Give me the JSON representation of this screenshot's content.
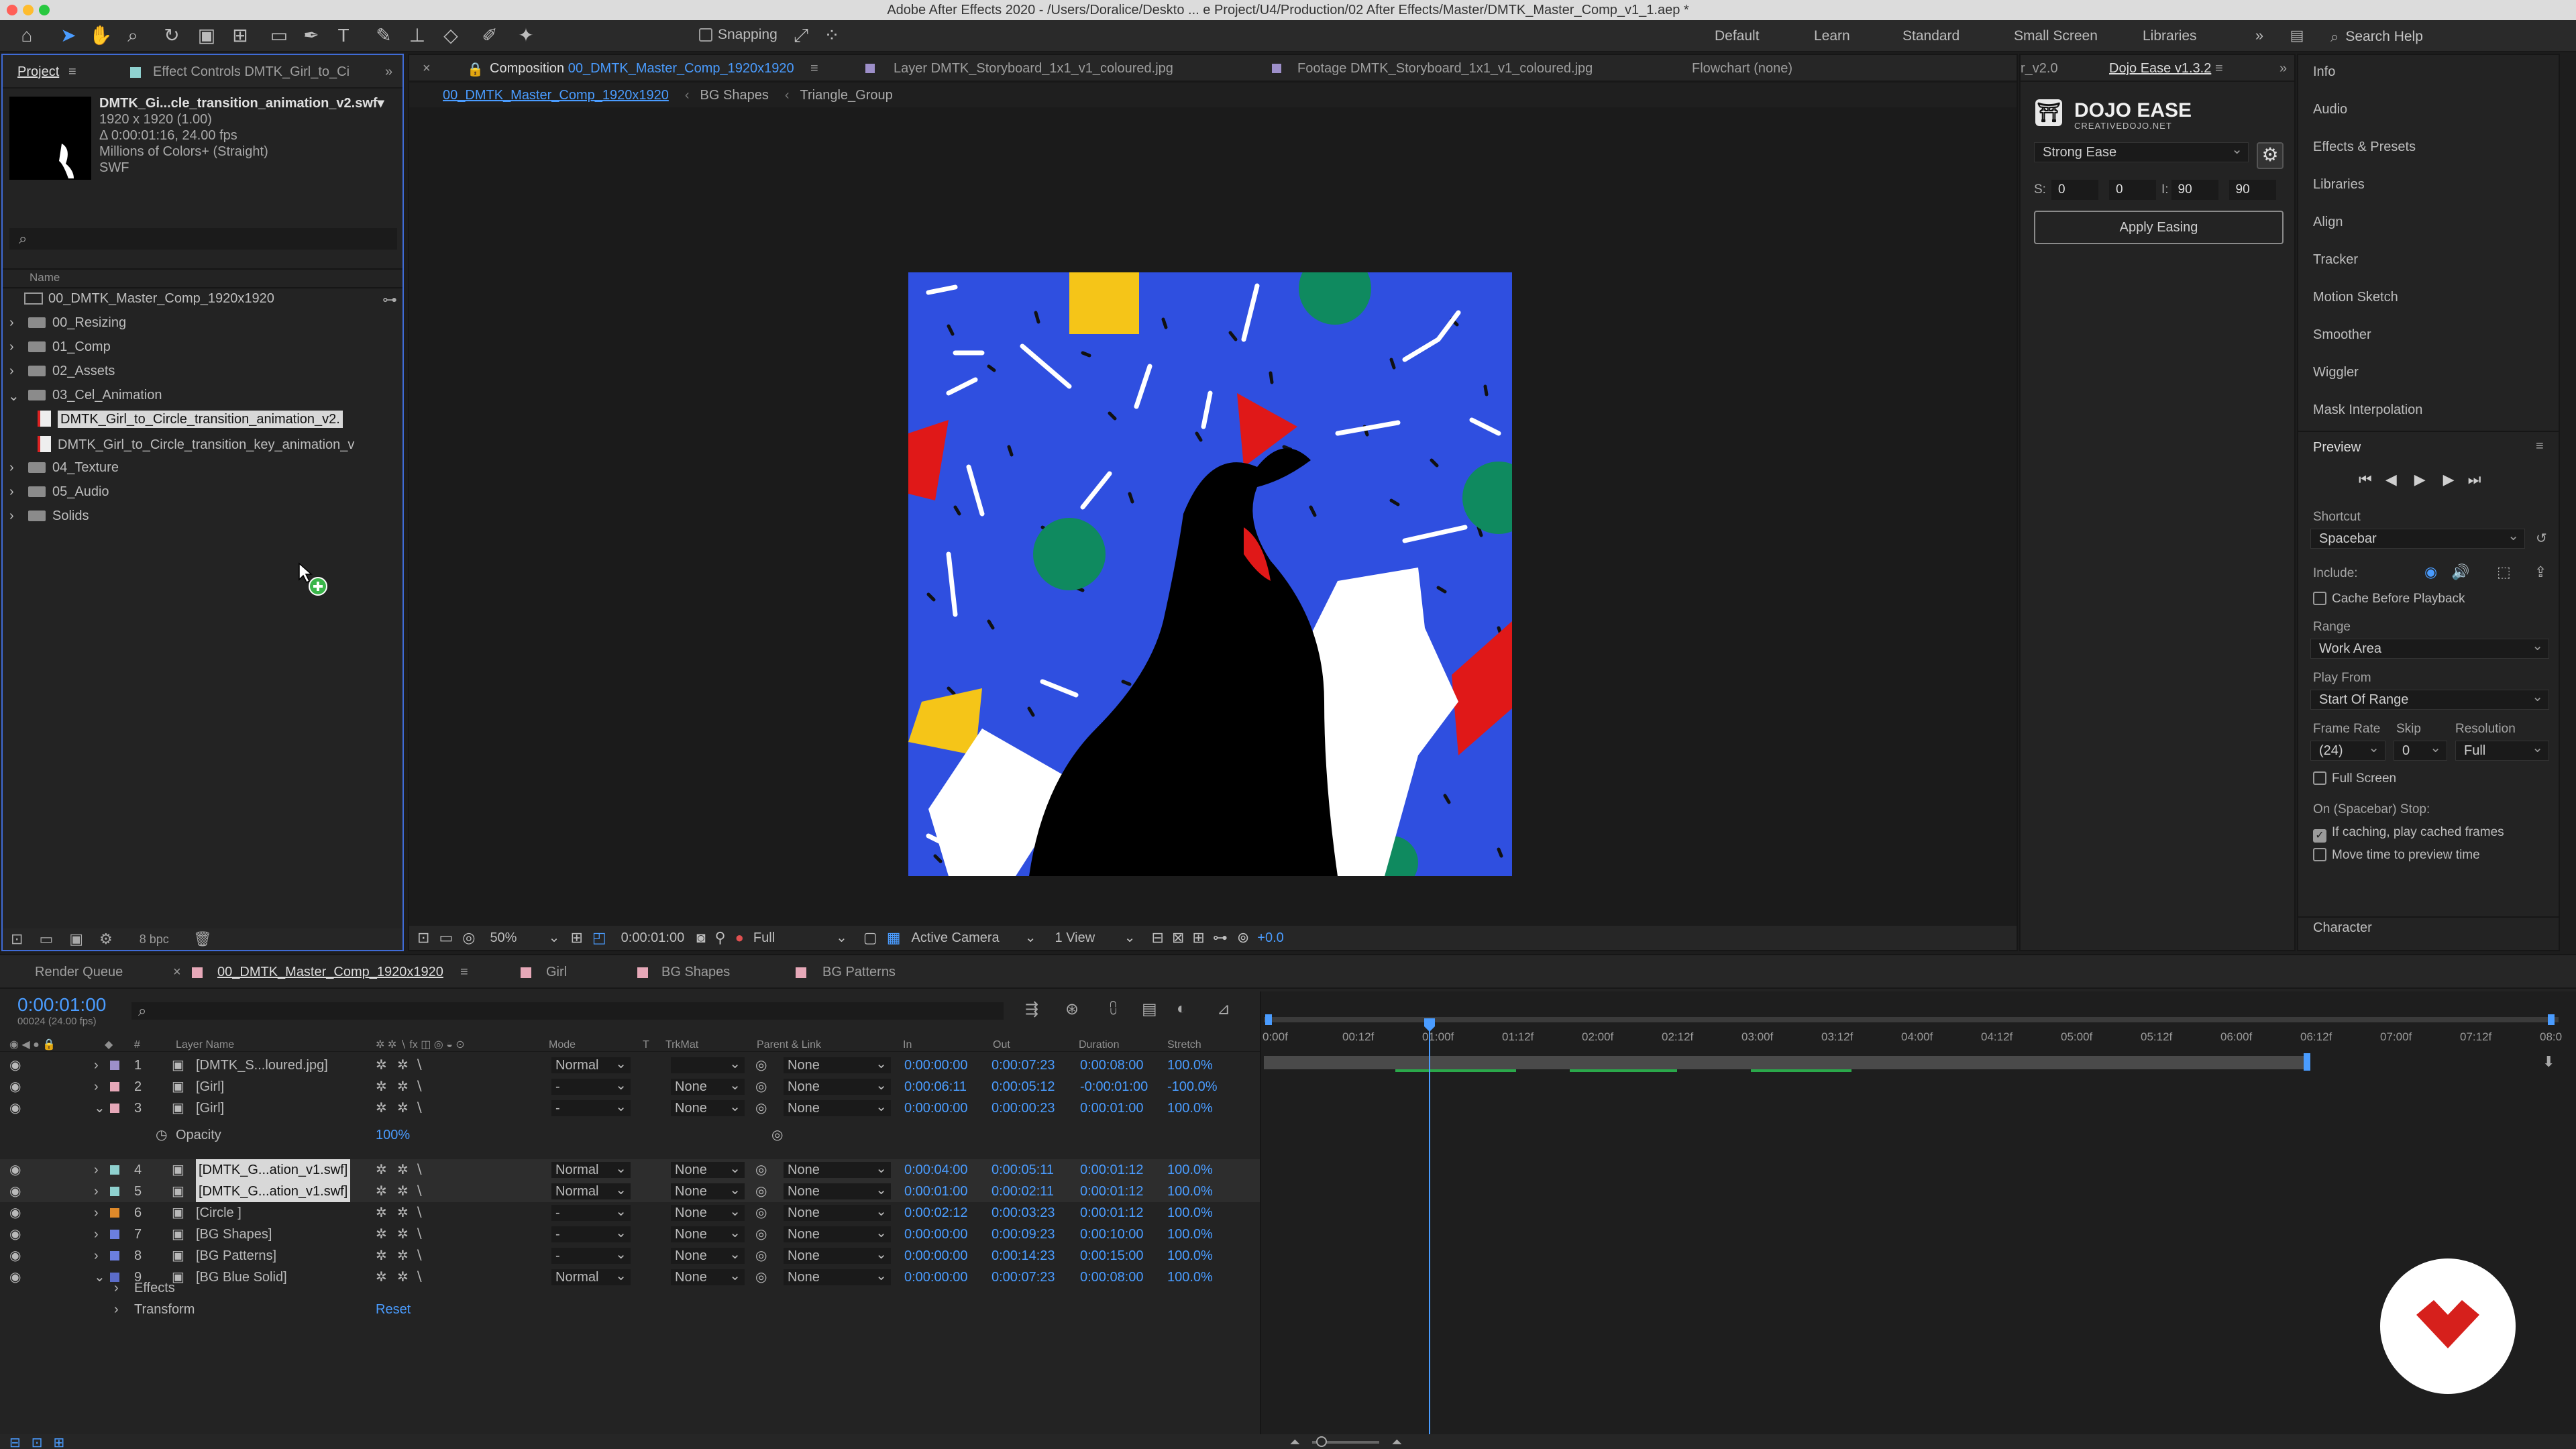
{
  "app": {
    "title": "Adobe After Effects 2020 - /Users/Doralice/Deskto ... e Project/U4/Production/02 After Effects/Master/DMTK_Master_Comp_v1_1.aep *"
  },
  "toolbar": {
    "snapping_label": "Snapping",
    "workspaces": [
      "Default",
      "Learn",
      "Standard",
      "Small Screen",
      "Libraries"
    ],
    "search_placeholder": "Search Help"
  },
  "project_panel": {
    "tab_project": "Project",
    "tab_effect_controls": "Effect Controls DMTK_Girl_to_Ci",
    "preview": {
      "name": "DMTK_Gi...cle_transition_animation_v2.swf▾",
      "line1": "1920 x 1920 (1.00)",
      "line2": "Δ 0:00:01:16, 24.00 fps",
      "line3": "Millions of Colors+ (Straight)",
      "line4": "SWF"
    },
    "column_name": "Name",
    "items": [
      {
        "label": "00_DMTK_Master_Comp_1920x1920",
        "type": "comp"
      },
      {
        "label": "00_Resizing",
        "type": "folder"
      },
      {
        "label": "01_Comp",
        "type": "folder"
      },
      {
        "label": "02_Assets",
        "type": "folder"
      },
      {
        "label": "03_Cel_Animation",
        "type": "folder-open"
      },
      {
        "label": "DMTK_Girl_to_Circle_transition_animation_v2.",
        "type": "swf"
      },
      {
        "label": "DMTK_Girl_to_Circle_transition_key_animation_v",
        "type": "swf"
      },
      {
        "label": "04_Texture",
        "type": "folder"
      },
      {
        "label": "05_Audio",
        "type": "folder"
      },
      {
        "label": "Solids",
        "type": "folder"
      }
    ],
    "bpc": "8 bpc"
  },
  "comp_panel": {
    "tab_composition_prefix": "Composition",
    "tab_composition_name": "00_DMTK_Master_Comp_1920x1920",
    "tab_layer": "Layer DMTK_Storyboard_1x1_v1_coloured.jpg",
    "tab_footage": "Footage DMTK_Storyboard_1x1_v1_coloured.jpg",
    "tab_flowchart": "Flowchart (none)",
    "breadcrumbs": [
      "00_DMTK_Master_Comp_1920x1920",
      "BG Shapes",
      "Triangle_Group"
    ],
    "footer": {
      "zoom": "50%",
      "time": "0:00:01:00",
      "resolution": "Full",
      "camera": "Active Camera",
      "views": "1 View",
      "exposure": "+0.0"
    }
  },
  "dojo_panel": {
    "tab_version_short": "r_v2.0",
    "tab_label": "Dojo Ease v1.3.2",
    "brand": "DOJO EASE",
    "brand_sub": "CREATIVEDOJO.NET",
    "preset": "Strong Ease",
    "s_label": "S:",
    "s_values": [
      "0",
      "0"
    ],
    "i_label": "I:",
    "i_values": [
      "90",
      "90"
    ],
    "apply_label": "Apply Easing"
  },
  "right_panel": {
    "items": [
      "Info",
      "Audio",
      "Effects & Presets",
      "Libraries",
      "Align",
      "Tracker",
      "Motion Sketch",
      "Smoother",
      "Wiggler",
      "Mask Interpolation"
    ],
    "preview": {
      "title": "Preview",
      "shortcut_label": "Shortcut",
      "shortcut_value": "Spacebar",
      "include_label": "Include:",
      "cache_label": "Cache Before Playback",
      "range_label": "Range",
      "range_value": "Work Area",
      "play_from_label": "Play From",
      "play_from_value": "Start Of Range",
      "frame_rate_label": "Frame Rate",
      "skip_label": "Skip",
      "resolution_label": "Resolution",
      "frame_rate_value": "(24)",
      "skip_value": "0",
      "resolution_value": "Full",
      "full_screen_label": "Full Screen",
      "stop_label": "On (Spacebar) Stop:",
      "if_caching_label": "If caching, play cached frames",
      "move_time_label": "Move time to preview time"
    },
    "character_label": "Character"
  },
  "timeline": {
    "tab_render_queue": "Render Queue",
    "tab_comp": "00_DMTK_Master_Comp_1920x1920",
    "tab_girl": "Girl",
    "tab_bg_shapes": "BG Shapes",
    "tab_bg_patterns": "BG Patterns",
    "current_time": "0:00:01:00",
    "frame_info": "00024 (24.00 fps)",
    "columns": {
      "layer_name": "Layer Name",
      "mode": "Mode",
      "t": "T",
      "trkmat": "TrkMat",
      "parent": "Parent & Link",
      "in": "In",
      "out": "Out",
      "duration": "Duration",
      "stretch": "Stretch",
      "num": "#"
    },
    "ruler_ticks": [
      "0:00f",
      "00:12f",
      "01:00f",
      "01:12f",
      "02:00f",
      "02:12f",
      "03:00f",
      "03:12f",
      "04:00f",
      "04:12f",
      "05:00f",
      "05:12f",
      "06:00f",
      "06:12f",
      "07:00f",
      "07:12f",
      "08:0"
    ],
    "layers": [
      {
        "num": "1",
        "name": "[DMTK_S...loured.jpg]",
        "color": "#9d8fc9",
        "mode": "Normal",
        "trkmat": "",
        "parent": "None",
        "in": "0:00:00:00",
        "out": "0:00:07:23",
        "duration": "0:00:08:00",
        "stretch": "100.0%"
      },
      {
        "num": "2",
        "name": "[Girl]",
        "color": "#e6a8b8",
        "mode": "-",
        "trkmat": "None",
        "parent": "None",
        "in": "0:00:06:11",
        "out": "0:00:05:12",
        "duration": "-0:00:01:00",
        "stretch": "-100.0%"
      },
      {
        "num": "3",
        "name": "[Girl]",
        "color": "#e6a8b8",
        "mode": "-",
        "trkmat": "None",
        "parent": "None",
        "in": "0:00:00:00",
        "out": "0:00:00:23",
        "duration": "0:00:01:00",
        "stretch": "100.0%"
      },
      {
        "num": "4",
        "name": "[DMTK_G...ation_v1.swf]",
        "color": "#8fd1cf",
        "mode": "Normal",
        "trkmat": "None",
        "parent": "None",
        "in": "0:00:04:00",
        "out": "0:00:05:11",
        "duration": "0:00:01:12",
        "stretch": "100.0%"
      },
      {
        "num": "5",
        "name": "[DMTK_G...ation_v1.swf]",
        "color": "#8fd1cf",
        "mode": "Normal",
        "trkmat": "None",
        "parent": "None",
        "in": "0:00:01:00",
        "out": "0:00:02:11",
        "duration": "0:00:01:12",
        "stretch": "100.0%"
      },
      {
        "num": "6",
        "name": "[Circle ]",
        "color": "#e08a2a",
        "mode": "-",
        "trkmat": "None",
        "parent": "None",
        "in": "0:00:02:12",
        "out": "0:00:03:23",
        "duration": "0:00:01:12",
        "stretch": "100.0%"
      },
      {
        "num": "7",
        "name": "[BG Shapes]",
        "color": "#6b7fe0",
        "mode": "-",
        "trkmat": "None",
        "parent": "None",
        "in": "0:00:00:00",
        "out": "0:00:09:23",
        "duration": "0:00:10:00",
        "stretch": "100.0%"
      },
      {
        "num": "8",
        "name": "[BG Patterns]",
        "color": "#6b7fe0",
        "mode": "-",
        "trkmat": "None",
        "parent": "None",
        "in": "0:00:00:00",
        "out": "0:00:14:23",
        "duration": "0:00:15:00",
        "stretch": "100.0%"
      },
      {
        "num": "9",
        "name": "[BG Blue Solid]",
        "color": "#5b6cc9",
        "mode": "Normal",
        "trkmat": "None",
        "parent": "None",
        "in": "0:00:00:00",
        "out": "0:00:07:23",
        "duration": "0:00:08:00",
        "stretch": "100.0%"
      }
    ],
    "opacity_label": "Opacity",
    "opacity_value": "100%",
    "effects_label": "Effects",
    "transform_label": "Transform",
    "reset_label": "Reset"
  },
  "colors": {
    "accent": "#4a9cff",
    "canvas_bg": "#2f4fe0",
    "badge": "#d6201c"
  }
}
